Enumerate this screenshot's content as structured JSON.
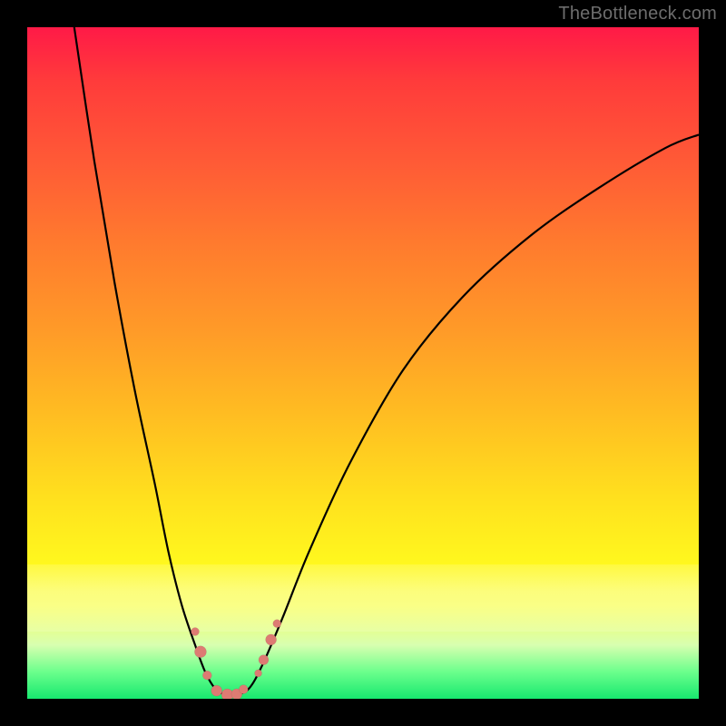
{
  "watermark": "TheBottleneck.com",
  "colors": {
    "frame": "#000000",
    "marker": "#dd7b73",
    "curve": "#000000"
  },
  "chart_data": {
    "type": "line",
    "title": "",
    "xlabel": "",
    "ylabel": "",
    "xlim": [
      0,
      100
    ],
    "ylim": [
      0,
      100
    ],
    "grid": false,
    "series": [
      {
        "name": "bottleneck-curve",
        "x": [
          7,
          10,
          13,
          16,
          19,
          21,
          23,
          25,
          26.5,
          28,
          29.5,
          31,
          33,
          35,
          38,
          42,
          48,
          56,
          65,
          75,
          85,
          95,
          100
        ],
        "y": [
          100,
          80,
          62,
          46,
          32,
          22,
          14,
          8,
          4,
          1.5,
          0.6,
          0.6,
          1.5,
          5,
          12,
          22,
          35,
          49,
          60,
          69,
          76,
          82,
          84
        ]
      }
    ],
    "markers": {
      "name": "highlight-points",
      "points": [
        {
          "x": 25.0,
          "y": 10.0,
          "r": 4.5
        },
        {
          "x": 25.8,
          "y": 7.0,
          "r": 6.5
        },
        {
          "x": 26.8,
          "y": 3.5,
          "r": 5.0
        },
        {
          "x": 28.2,
          "y": 1.2,
          "r": 6.0
        },
        {
          "x": 29.8,
          "y": 0.6,
          "r": 6.5
        },
        {
          "x": 31.2,
          "y": 0.7,
          "r": 6.0
        },
        {
          "x": 32.2,
          "y": 1.4,
          "r": 5.0
        },
        {
          "x": 34.4,
          "y": 3.8,
          "r": 4.0
        },
        {
          "x": 35.2,
          "y": 5.8,
          "r": 5.5
        },
        {
          "x": 36.3,
          "y": 8.8,
          "r": 6.0
        },
        {
          "x": 37.2,
          "y": 11.2,
          "r": 4.5
        }
      ]
    }
  }
}
